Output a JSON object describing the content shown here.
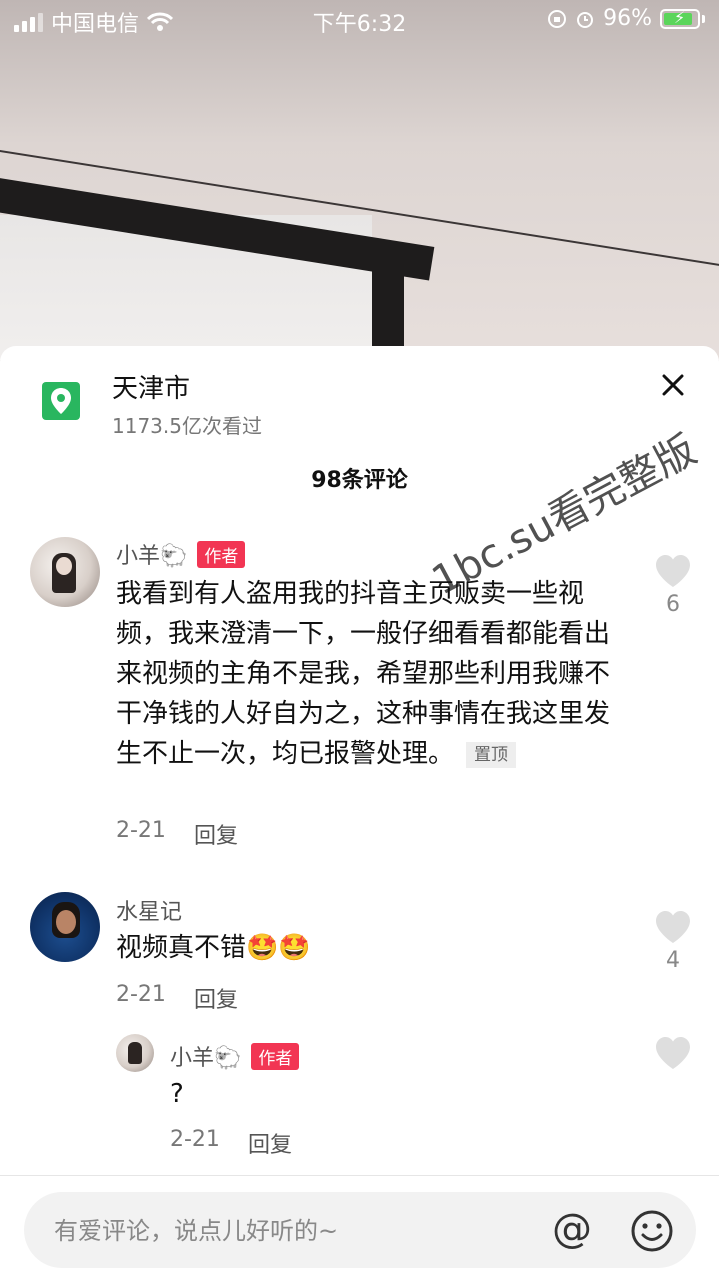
{
  "status_bar": {
    "carrier": "中国电信",
    "time": "下午6:32",
    "battery": "96%"
  },
  "location": {
    "title": "天津市",
    "views": "1173.5亿次看过"
  },
  "comments_header": "98条评论",
  "watermark": "1bc.su看完整版",
  "comments": [
    {
      "user": "小羊🐑",
      "tag": "作者",
      "text": "我看到有人盗用我的抖音主页贩卖一些视频，我来澄清一下，一般仔细看看都能看出来视频的主角不是我，希望那些利用我赚不干净钱的人好自为之，这种事情在我这里发生不止一次，均已报警处理。",
      "pinned": "置顶",
      "date": "2-21",
      "reply": "回复",
      "likes": "6"
    },
    {
      "user": "水星记",
      "text": "视频真不错🤩🤩",
      "date": "2-21",
      "reply": "回复",
      "likes": "4"
    },
    {
      "user": "小羊🐑",
      "tag": "作者",
      "text": "?",
      "date": "2-21",
      "reply": "回复"
    }
  ],
  "input": {
    "placeholder": "有爱评论，说点儿好听的~"
  },
  "colors": {
    "accent": "#f23553",
    "location_green": "#29b65f"
  }
}
